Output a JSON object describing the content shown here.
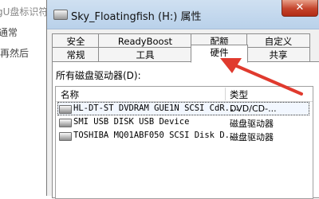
{
  "background": {
    "line1": "gU盘标识符",
    "line2": "通常",
    "line3": "再然后"
  },
  "window": {
    "title": "Sky_Floatingfish (H:) 属性",
    "close_glyph": "✕"
  },
  "tabs": {
    "row_back": [
      {
        "label": "安全"
      },
      {
        "label": "ReadyBoost"
      },
      {
        "label": "配额"
      },
      {
        "label": "自定义"
      }
    ],
    "row_front": [
      {
        "label": "常规"
      },
      {
        "label": "工具"
      },
      {
        "label": "硬件",
        "active": true
      },
      {
        "label": "共享"
      }
    ]
  },
  "hardware": {
    "disk_list_label": "所有磁盘驱动器(D):",
    "columns": {
      "name": "名称",
      "type": "类型"
    },
    "rows": [
      {
        "name": "HL-DT-ST DVDRAM GUE1N SCSI CdR...",
        "type": "DVD/CD-...",
        "selected": true
      },
      {
        "name": "SMI USB DISK USB Device",
        "type": "磁盘驱动器"
      },
      {
        "name": "TOSHIBA MQ01ABF050 SCSI Disk D...",
        "type": "磁盘驱动器"
      }
    ]
  },
  "annotation": {
    "arrow_color": "#e03a2e"
  },
  "icons": [
    "drive-icon",
    "close-icon",
    "arrow-annotation"
  ]
}
